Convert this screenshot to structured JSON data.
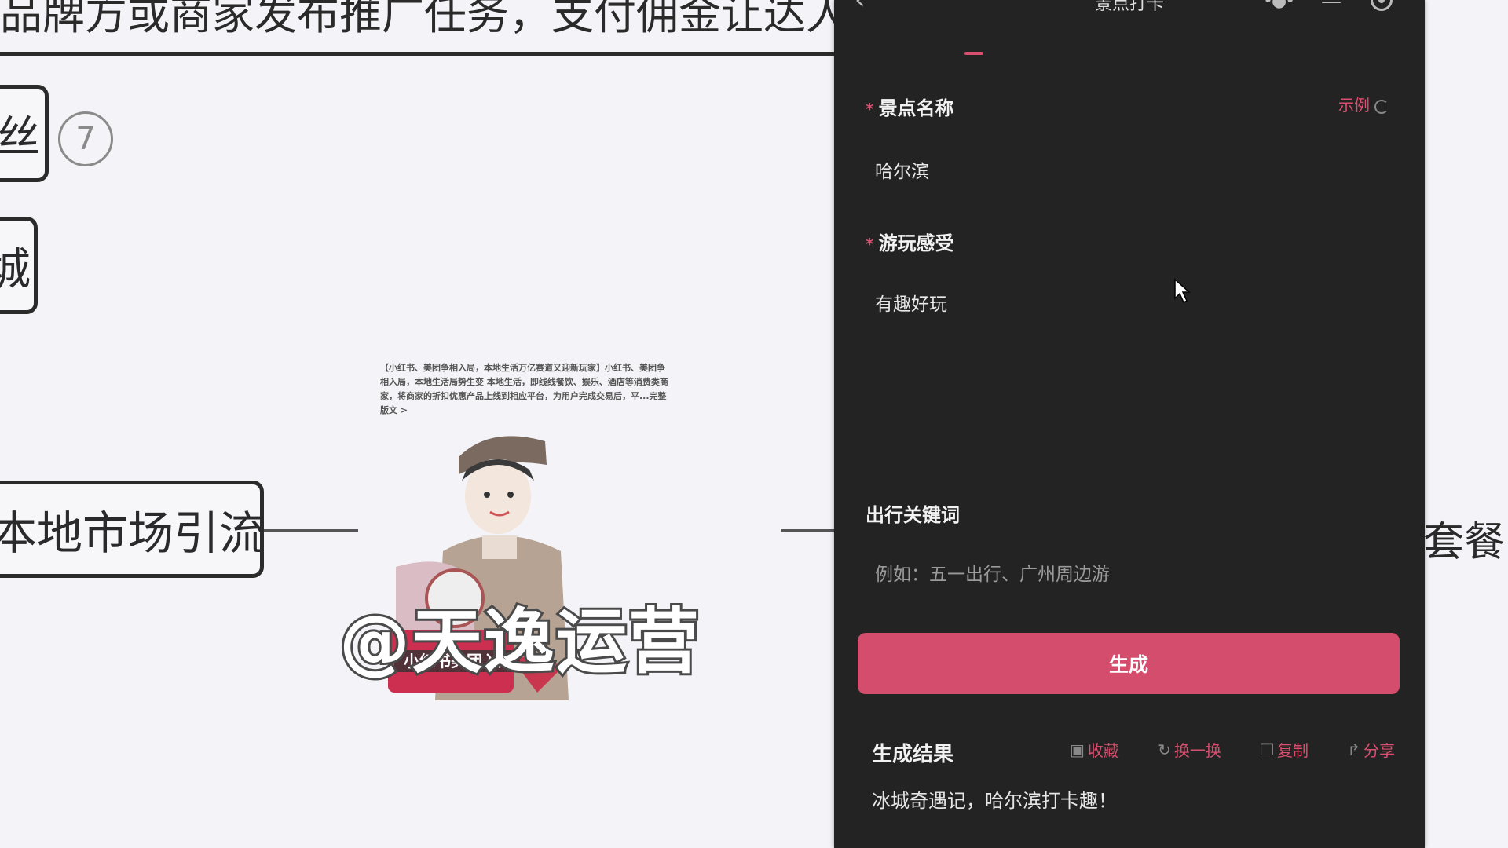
{
  "background": {
    "top_text": "品牌方或商家发布推广任务，支付佣金让达人",
    "node1": "丝",
    "node2": "城",
    "node3": "本地市场引流",
    "circle_number": "7",
    "right_text": "套餐"
  },
  "card": {
    "text": "【小红书、美团争相入局，本地生活万亿赛道又迎新玩家】小红书、美团争相入局，本地生活局势生变 本地生活，即线线餐饮、娱乐、酒店等消费类商家，将商家的折扣优惠产品上线到相应平台，为用户完成交易后，平...完整版文 >",
    "badge": "小红书美团入局",
    "watermark": "@天逸运营"
  },
  "app": {
    "title": "景点打卡",
    "fields": {
      "spot_label": "景点名称",
      "spot_value": "哈尔滨",
      "feel_label": "游玩感受",
      "feel_value": "有趣好玩",
      "keyword_label": "出行关键词",
      "keyword_placeholder": "例如：五一出行、广州周边游"
    },
    "required_mark": "*",
    "example_label": "示例",
    "generate_button": "生成",
    "result": {
      "title": "生成结果",
      "actions": [
        "收藏",
        "换一换",
        "复制",
        "分享"
      ],
      "text": "冰城奇遇记，哈尔滨打卡趣！"
    },
    "accent_color": "#d44d6c"
  }
}
